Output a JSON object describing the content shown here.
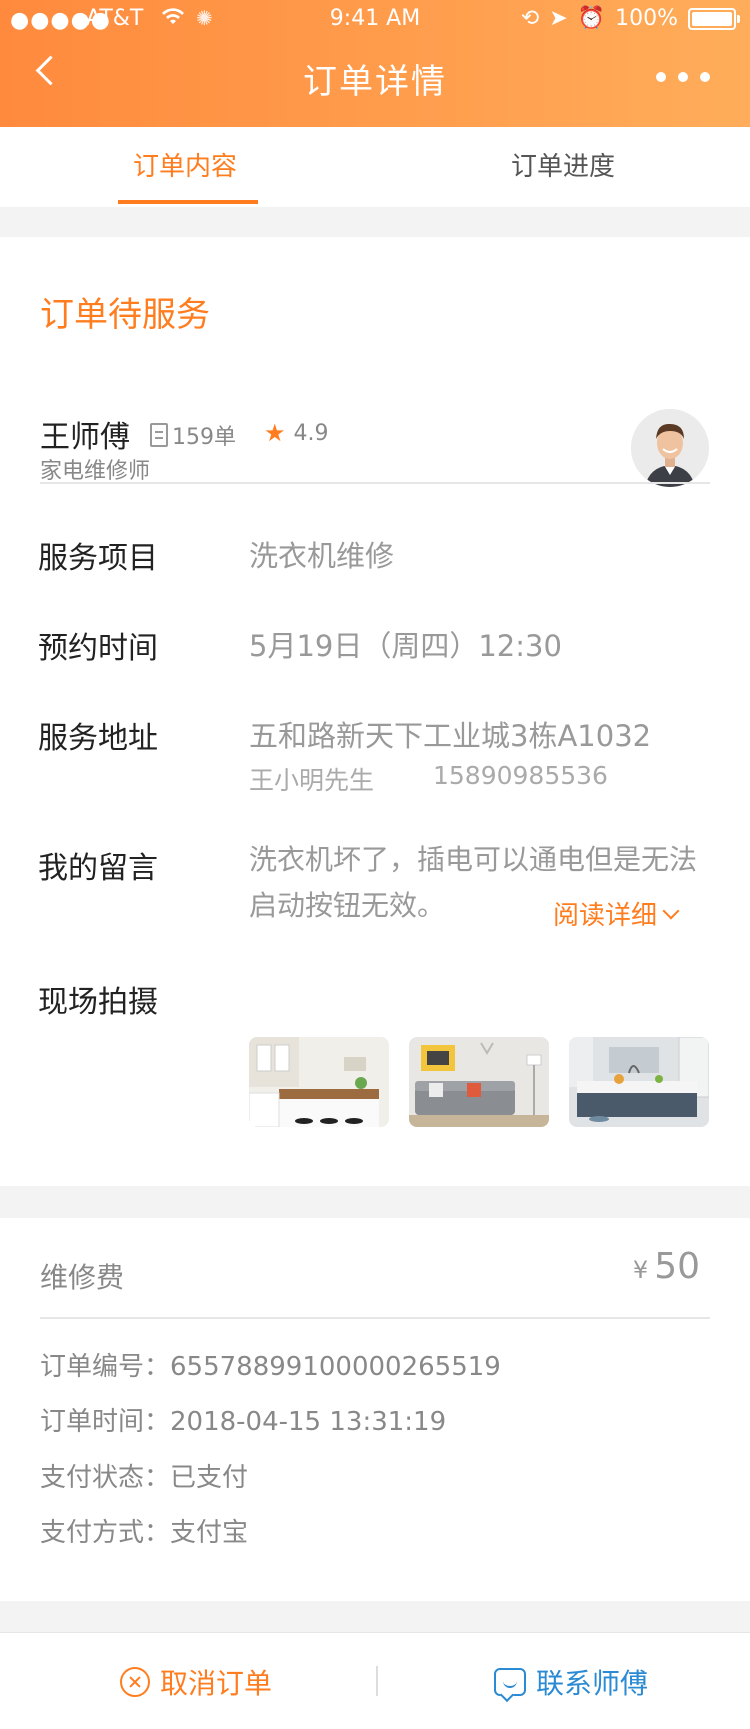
{
  "status_bar": {
    "signal": "●●●●●",
    "carrier": "AT&T",
    "time": "9:41 AM",
    "battery_text": "100%",
    "battery_level": 1.0
  },
  "nav": {
    "title": "订单详情"
  },
  "tabs": [
    {
      "label": "订单内容",
      "active": true
    },
    {
      "label": "订单进度",
      "active": false
    }
  ],
  "order": {
    "status_title": "订单待服务",
    "worker": {
      "name": "王师傅",
      "orders": "159单",
      "rating": "4.9",
      "role": "家电维修师"
    },
    "rows": {
      "service_label": "服务项目",
      "service_value": "洗衣机维修",
      "time_label": "预约时间",
      "time_value": "5月19日（周四）12:30",
      "address_label": "服务地址",
      "address_value": "五和路新天下工业城3栋A1032",
      "contact_name": "王小明先生",
      "contact_phone": "15890985536",
      "message_label": "我的留言",
      "message_value": "洗衣机坏了，插电可以通电但是无法启动按钮无效。",
      "read_more": "阅读详细",
      "photos_label": "现场拍摄"
    }
  },
  "payment": {
    "fee_label": "维修费",
    "currency": "¥",
    "fee_value": "50",
    "order_no": "订单编号：6557889910000026551 9",
    "order_no_text": "订单编号：65578899100000265519",
    "order_time": "订单时间：2018-04-15  13:31:19",
    "pay_status": "支付状态：已支付",
    "pay_method": "支付方式：支付宝"
  },
  "actions": {
    "cancel": "取消订单",
    "contact": "联系师傅"
  },
  "colors": {
    "accent": "#ff7d1f",
    "link": "#2a8ad4",
    "header_start": "#ff8a3d",
    "header_end": "#ffad5a"
  }
}
